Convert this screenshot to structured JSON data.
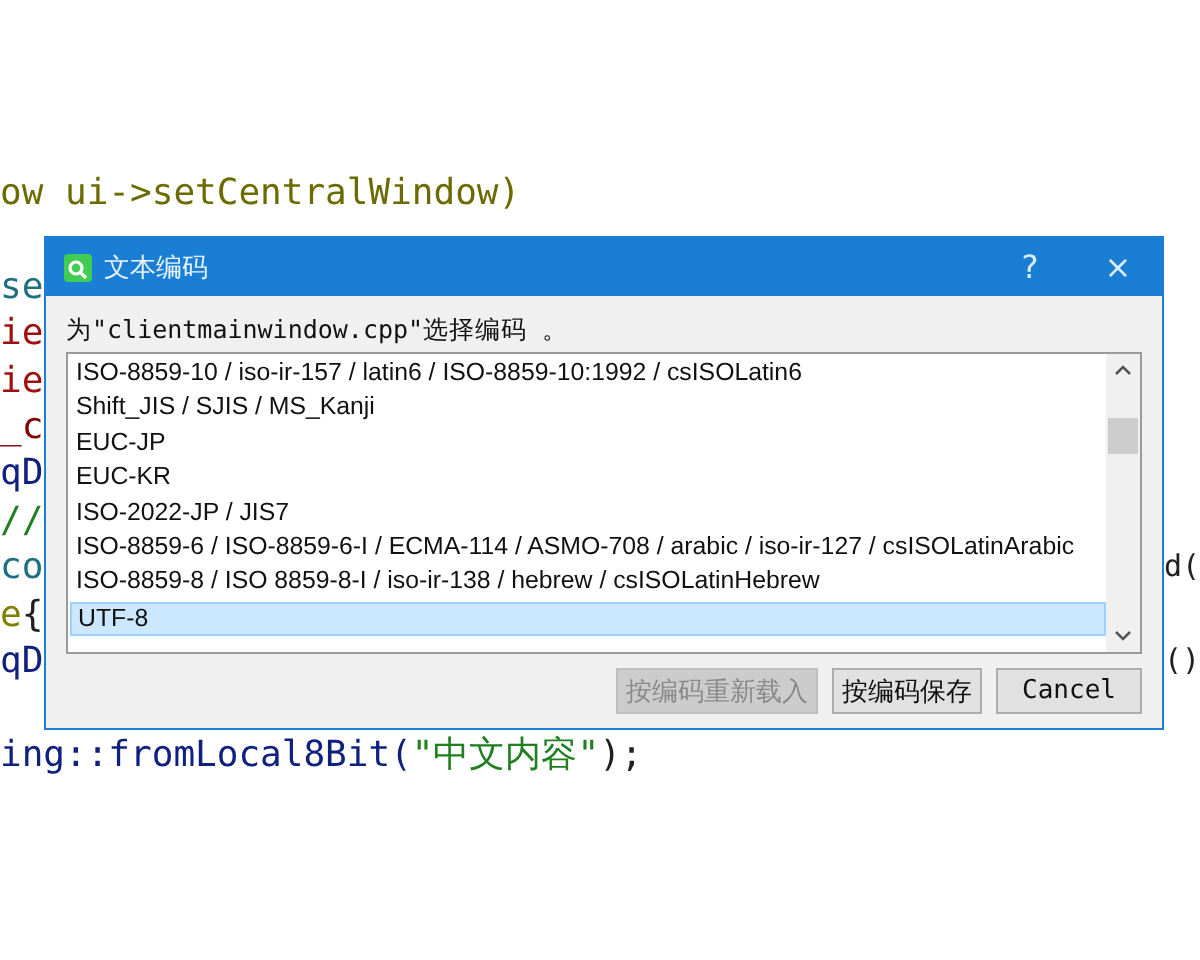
{
  "editor": {
    "lines": [
      {
        "kind": "code",
        "left": [
          {
            "text": "ow ui->setCentralWindow)",
            "color": "#6b6b00"
          }
        ]
      },
      {
        "kind": "hidden"
      },
      {
        "kind": "code",
        "left": [
          {
            "text": "se",
            "color": "#1f6f7f"
          }
        ]
      },
      {
        "kind": "code",
        "left": [
          {
            "text": "ie",
            "color": "#a01010"
          }
        ]
      },
      {
        "kind": "code",
        "left": [
          {
            "text": "ie",
            "color": "#a01010"
          }
        ]
      },
      {
        "kind": "code",
        "left": [
          {
            "text": "_c",
            "color": "#800000"
          }
        ]
      },
      {
        "kind": "code",
        "left": [
          {
            "text": "qD",
            "color": "#10207f"
          }
        ]
      },
      {
        "kind": "code",
        "left": [
          {
            "text": "//",
            "color": "#208020"
          }
        ]
      },
      {
        "kind": "code",
        "left": [
          {
            "text": "co",
            "color": "#1f6f7f"
          }
        ],
        "right": {
          "text": "d(",
          "color": "#202020"
        }
      },
      {
        "kind": "code",
        "left": [
          {
            "text": "e",
            "color": "#808000"
          },
          {
            "text": "{",
            "color": "#202020"
          }
        ]
      },
      {
        "kind": "code",
        "left": [
          {
            "text": "qD",
            "color": "#10207f"
          }
        ],
        "right": {
          "text": "()",
          "color": "#202020"
        }
      },
      {
        "kind": "hidden"
      },
      {
        "kind": "code",
        "left": [
          {
            "text": "ing::fromLocal8Bit(",
            "color": "#10207f"
          },
          {
            "text": "\"中文内容\"",
            "color": "#208020"
          },
          {
            "text": ");",
            "color": "#202020"
          }
        ]
      }
    ]
  },
  "dialog": {
    "title": "文本编码",
    "help": "?",
    "close": "×",
    "prompt": "为\"clientmainwindow.cpp\"选择编码 。",
    "encodings": [
      {
        "label": "ISO-8859-10 / iso-ir-157 / latin6 / ISO-8859-10:1992 / csISOLatin6",
        "selected": false
      },
      {
        "label": "Shift_JIS / SJIS / MS_Kanji",
        "selected": false
      },
      {
        "label": "EUC-JP",
        "selected": false
      },
      {
        "label": "EUC-KR",
        "selected": false
      },
      {
        "label": "ISO-2022-JP / JIS7",
        "selected": false
      },
      {
        "label": "ISO-8859-6 / ISO-8859-6-I / ECMA-114 / ASMO-708 / arabic / iso-ir-127 / csISOLatinArabic",
        "selected": false
      },
      {
        "label": "ISO-8859-8 / ISO 8859-8-I / iso-ir-138 / hebrew / csISOLatinHebrew",
        "selected": false
      },
      {
        "label": "UTF-8",
        "selected": true
      }
    ],
    "buttons": [
      {
        "label": "按编码重新载入",
        "disabled": true
      },
      {
        "label": "按编码保存",
        "disabled": false
      },
      {
        "label": "Cancel",
        "disabled": false
      }
    ]
  }
}
